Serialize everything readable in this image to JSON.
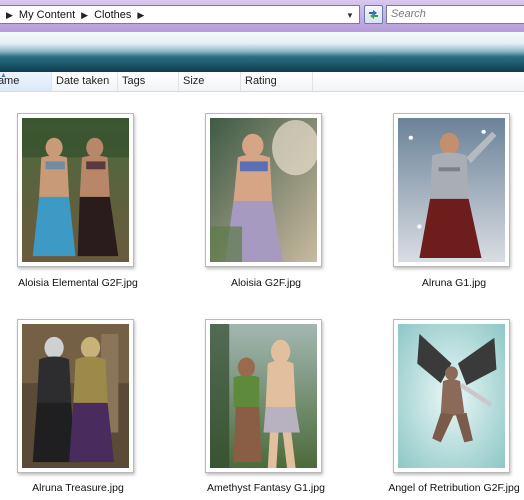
{
  "address": {
    "breadcrumbs": [
      "My Content",
      "Clothes"
    ],
    "search_placeholder": "Search"
  },
  "columns": [
    "Name",
    "Date taken",
    "Tags",
    "Size",
    "Rating"
  ],
  "files": [
    {
      "name": "Aloisia Elemental G2F.jpg",
      "thumb": "two-figures-jungle-thumbnail"
    },
    {
      "name": "Aloisia G2F.jpg",
      "thumb": "figure-dress-jungle-thumbnail"
    },
    {
      "name": "Alruna G1.jpg",
      "thumb": "armored-figure-snow-thumbnail"
    },
    {
      "name": "Alruna Treasure.jpg",
      "thumb": "two-armored-figures-thumbnail"
    },
    {
      "name": "Amethyst Fantasy G1.jpg",
      "thumb": "two-figures-forest-thumbnail"
    },
    {
      "name": "Angel of Retribution G2F.jpg",
      "thumb": "winged-figure-sky-thumbnail"
    }
  ]
}
